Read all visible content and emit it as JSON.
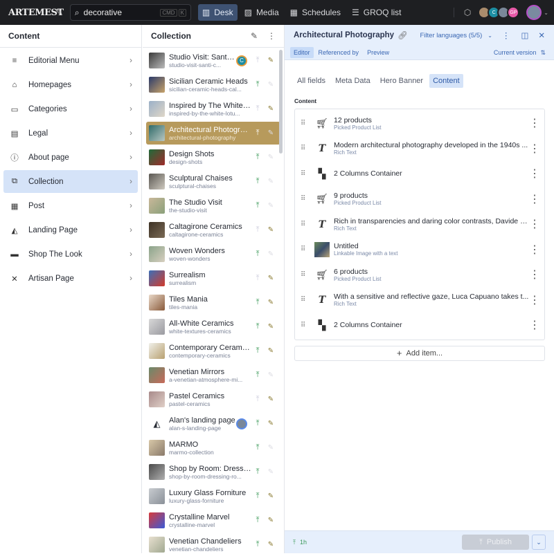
{
  "topbar": {
    "logo": "ARTEMEST",
    "search_value": "decorative",
    "kbd": [
      "CMD",
      "K"
    ],
    "nav": [
      {
        "label": "Desk",
        "icon": "desk-icon",
        "active": true
      },
      {
        "label": "Media",
        "icon": "image-icon"
      },
      {
        "label": "Schedules",
        "icon": "calendar-icon"
      },
      {
        "label": "GROQ list",
        "icon": "list-icon"
      }
    ],
    "avatars": [
      {
        "initials": "",
        "color": "#a98b6c"
      },
      {
        "initials": "C",
        "color": "#1d8ea3"
      },
      {
        "initials": "",
        "color": "#7a8799"
      },
      {
        "initials": "GP",
        "color": "#e85aa8"
      }
    ]
  },
  "sidebar": {
    "title": "Content",
    "items": [
      {
        "label": "Editorial Menu",
        "icon": "menu-icon"
      },
      {
        "label": "Homepages",
        "icon": "home-icon"
      },
      {
        "label": "Categories",
        "icon": "folder-icon"
      },
      {
        "label": "Legal",
        "icon": "document-icon"
      },
      {
        "label": "About page",
        "icon": "info-icon"
      },
      {
        "label": "Collection",
        "icon": "collection-icon",
        "selected": true
      },
      {
        "label": "Post",
        "icon": "post-icon"
      },
      {
        "label": "Landing Page",
        "icon": "shapes-icon"
      },
      {
        "label": "Shop The Look",
        "icon": "sofa-icon"
      },
      {
        "label": "Artisan Page",
        "icon": "tools-icon"
      }
    ]
  },
  "collection": {
    "title": "Collection",
    "items": [
      {
        "title": "Studio Visit: Santi Ceramics",
        "slug": "studio-visit-santi-c...",
        "published": false,
        "draft": true,
        "avatar": "C",
        "thumb": [
          "#3a3a3a",
          "#bbbbbb"
        ]
      },
      {
        "title": "Sicilian Ceramic Heads",
        "slug": "sicilian-ceramic-heads-cal...",
        "published": true,
        "draft": false,
        "thumb": [
          "#2b3a6a",
          "#c9a46a"
        ]
      },
      {
        "title": "Inspired by The White Lotus",
        "slug": "inspired-by-the-white-lotu...",
        "published": false,
        "draft": true,
        "thumb": [
          "#9bb0c8",
          "#e0d7c8"
        ]
      },
      {
        "title": "Architectural Photography",
        "slug": "architectural-photography",
        "published": true,
        "draft": false,
        "selected": true,
        "thumb": [
          "#2e6b6a",
          "#b9c7c2"
        ]
      },
      {
        "title": "Design Shots",
        "slug": "design-shots",
        "published": true,
        "draft": false,
        "thumb": [
          "#1f6b3a",
          "#a02a2a"
        ]
      },
      {
        "title": "Sculptural Chaises",
        "slug": "sculptural-chaises",
        "published": true,
        "draft": false,
        "thumb": [
          "#5a5752",
          "#cfcac0"
        ]
      },
      {
        "title": "The Studio Visit",
        "slug": "the-studio-visit",
        "published": true,
        "draft": false,
        "thumb": [
          "#c9b89a",
          "#8aa07a"
        ]
      },
      {
        "title": "Caltagirone Ceramics",
        "slug": "caltagirone-ceramics",
        "published": false,
        "draft": true,
        "thumb": [
          "#3d3226",
          "#7a6a55"
        ]
      },
      {
        "title": "Woven Wonders",
        "slug": "woven-wonders",
        "published": true,
        "draft": false,
        "thumb": [
          "#8ba38a",
          "#d8d0c0"
        ]
      },
      {
        "title": "Surrealism",
        "slug": "surrealism",
        "published": false,
        "draft": true,
        "thumb": [
          "#3c6fb8",
          "#d33a2a"
        ]
      },
      {
        "title": "Tiles Mania",
        "slug": "tiles-mania",
        "published": true,
        "draft": true,
        "thumb": [
          "#e8d8c8",
          "#8a5a3a"
        ]
      },
      {
        "title": "All-White Ceramics",
        "slug": "white-textures-ceramics",
        "published": true,
        "draft": true,
        "thumb": [
          "#d8d8d8",
          "#9a9aa0"
        ]
      },
      {
        "title": "Contemporary Ceramics",
        "slug": "contemporary-ceramics",
        "published": true,
        "draft": true,
        "thumb": [
          "#f0f0ea",
          "#b8a070"
        ]
      },
      {
        "title": "Venetian Mirrors",
        "slug": "a-venetian-atmosphere-mi...",
        "published": true,
        "draft": false,
        "thumb": [
          "#6a8a6a",
          "#c86a5a"
        ]
      },
      {
        "title": "Pastel Ceramics",
        "slug": "pastel-ceramics",
        "published": false,
        "draft": true,
        "thumb": [
          "#a88a8a",
          "#e0d0c8"
        ]
      },
      {
        "title": "Alan's landing page",
        "slug": "alan-s-landing-page",
        "published": true,
        "draft": true,
        "avatar": "",
        "icon": true
      },
      {
        "title": "MARMO",
        "slug": "marmo-collection",
        "published": true,
        "draft": false,
        "thumb": [
          "#d8c8a8",
          "#8a7a6a"
        ]
      },
      {
        "title": "Shop by Room: Dressing Room",
        "slug": "shop-by-room-dressing-ro...",
        "published": true,
        "draft": false,
        "thumb": [
          "#4a4a4a",
          "#b0b0b0"
        ]
      },
      {
        "title": "Luxury Glass Forniture",
        "slug": "luxury-glass-forniture",
        "published": true,
        "draft": true,
        "thumb": [
          "#c8ccd0",
          "#8a9098"
        ]
      },
      {
        "title": "Crystalline Marvel",
        "slug": "crystalline-marvel",
        "published": true,
        "draft": true,
        "thumb": [
          "#d83a3a",
          "#3a5ad8"
        ]
      },
      {
        "title": "Venetian Chandeliers",
        "slug": "venetian-chandeliers",
        "published": true,
        "draft": true,
        "thumb": [
          "#e8e0d0",
          "#a0a890"
        ]
      }
    ]
  },
  "document": {
    "title": "Architectural Photography",
    "filter_languages": "Filter languages (5/5)",
    "tabs": [
      "Editor",
      "Referenced by",
      "Preview"
    ],
    "version": "Current version",
    "field_tabs": [
      "All fields",
      "Meta Data",
      "Hero Banner",
      "Content"
    ],
    "field_label": "Content",
    "items": [
      {
        "title": "12 products",
        "subtitle": "Picked Product List",
        "icon": "cart-icon"
      },
      {
        "title": "Modern architectural photography developed in the 1940s ...",
        "subtitle": "Rich Text",
        "icon": "text-icon"
      },
      {
        "title": "2 Columns Container",
        "subtitle": "",
        "icon": "columns-icon"
      },
      {
        "title": "9 products",
        "subtitle": "Picked Product List",
        "icon": "cart-icon"
      },
      {
        "title": "Rich in transparencies and daring color contrasts, Davide B...",
        "subtitle": "Rich Text",
        "icon": "text-icon"
      },
      {
        "title": "Untitled",
        "subtitle": "Linkable Image with a text",
        "icon": "image"
      },
      {
        "title": "6 products",
        "subtitle": "Picked Product List",
        "icon": "cart-icon"
      },
      {
        "title": "With a sensitive and reflective gaze, Luca Capuano takes t...",
        "subtitle": "Rich Text",
        "icon": "text-icon"
      },
      {
        "title": "2 Columns Container",
        "subtitle": "",
        "icon": "columns-icon"
      }
    ],
    "add_item": "Add item...",
    "status_time": "1h",
    "publish": "Publish"
  }
}
